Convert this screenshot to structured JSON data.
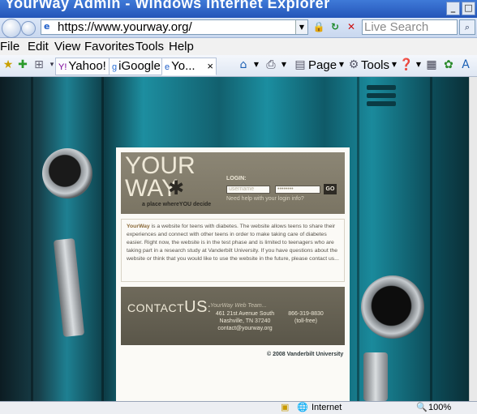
{
  "window": {
    "title": "YourWay Admin - Windows Internet Explorer",
    "min": "_",
    "max": "□",
    "close": "x"
  },
  "navbar": {
    "url": "https://www.yourway.org/",
    "search_placeholder": "Live Search"
  },
  "menu": [
    "File",
    "Edit",
    "View",
    "Favorites",
    "Tools",
    "Help"
  ],
  "tabs": [
    {
      "label": "Yahoo!",
      "icon": "yahoo-icon"
    },
    {
      "label": "iGoogle",
      "icon": "igoogle-icon"
    },
    {
      "label": "Yo...",
      "icon": "ie-icon",
      "close": "×"
    }
  ],
  "toolbar": {
    "page_label": "Page",
    "tools_label": "Tools"
  },
  "site": {
    "logo_line1": "YOUR",
    "logo_line2": "WAY",
    "asterisk": "✱",
    "tagline": "a place whereYOU decide",
    "login_label": "LOGIN:",
    "username_placeholder": "username",
    "password_value": "••••••••",
    "go_label": "GO",
    "need_help": "Need help with your login info?",
    "about_brand": "YourWay",
    "about_text": " is a website for teens with diabetes. The website allows teens to share their experiences and connect with other teens in order to make taking care of diabetes easier. Right now, the website is in the test phase and is limited to teenagers who are taking part in a research study at Vanderbilt University. If you have questions about the website or think that you would like to use the website in the future, please contact us...",
    "contact_word": "CONTACT",
    "contact_us": "US",
    "contact_colon": ":",
    "team": "YourWay Web Team...",
    "address_line1": "461 21st Avenue South",
    "address_line2": "Nashville, TN 37240",
    "email": "contact@yourway.org",
    "phone": "866-319-8830",
    "phone_note": "(toll-free)",
    "copyright": "© 2008 Vanderbilt University"
  },
  "status": {
    "zone": "Internet",
    "zoom": "100%"
  }
}
